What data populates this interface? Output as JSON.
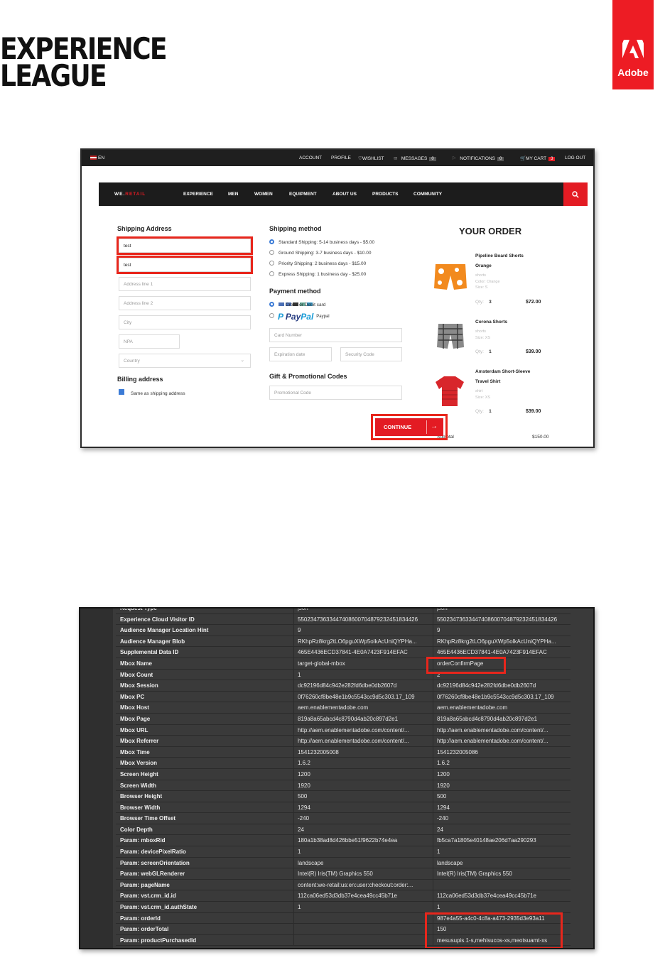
{
  "header": {
    "brand_line1": "EXPERIENCE",
    "brand_line2": "LEAGUE",
    "adobe_label": "Adobe",
    "accent": "#ed1c24"
  },
  "checkout": {
    "topbar": {
      "language": "EN",
      "links": [
        "ACCOUNT",
        "PROFILE",
        "WISHLIST",
        "MESSAGES",
        "NOTIFICATIONS",
        "MY CART",
        "LOG OUT"
      ],
      "messages_count": "0",
      "notifications_count": "0",
      "cart_count": "3"
    },
    "nav": {
      "logo_prefix": "WE.",
      "logo_suffix": "RETAIL",
      "items": [
        "EXPERIENCE",
        "MEN",
        "WOMEN",
        "EQUIPMENT",
        "ABOUT US",
        "PRODUCTS",
        "COMMUNITY"
      ]
    },
    "shipping_address": {
      "title": "Shipping Address",
      "first_name": "test",
      "last_name": "test",
      "address1_placeholder": "Address line 1",
      "address2_placeholder": "Address line 2",
      "city_placeholder": "City",
      "npa_placeholder": "NPA",
      "country_placeholder": "Country"
    },
    "billing": {
      "title": "Billing address",
      "same_as_shipping": "Same as shipping address"
    },
    "shipping_method": {
      "title": "Shipping method",
      "options": [
        "Standard Shipping: 5-14 business days - $5.00",
        "Ground Shipping: 3-7 business days - $10.00",
        "Priority Shipping: 2 business days - $15.00",
        "Express Shipping: 1 business day - $25.00"
      ]
    },
    "payment": {
      "title": "Payment method",
      "card_option": "Credit or Debit card",
      "paypal_word1": "Pay",
      "paypal_word2": "Pal",
      "paypal_option": "Paypal",
      "card_number_placeholder": "Card Number",
      "expiration_placeholder": "Expiration date",
      "security_placeholder": "Security Code"
    },
    "promo": {
      "title": "Gift & Promotional Codes",
      "placeholder": "Promotional Code"
    },
    "continue_label": "CONTINUE",
    "order": {
      "title": "YOUR ORDER",
      "items": [
        {
          "name": "Pipeline Board Shorts Orange",
          "type": "shorts",
          "color": "Color: Orange",
          "size": "Size: S",
          "qty_label": "Qty:",
          "qty": "3",
          "price": "$72.00"
        },
        {
          "name": "Corona Shorts",
          "type": "shorts",
          "color": "",
          "size": "Size: XS",
          "qty_label": "Qty:",
          "qty": "1",
          "price": "$39.00"
        },
        {
          "name": "Amsterdam Short-Sleeve Travel Shirt",
          "type": "shirt",
          "color": "",
          "size": "Size: XS",
          "qty_label": "Qty:",
          "qty": "1",
          "price": "$39.00"
        }
      ],
      "subtotal_label": "Subtotal",
      "subtotal": "$150.00"
    }
  },
  "debugger": {
    "rows": [
      [
        "Request Type",
        "json",
        "json"
      ],
      [
        "Experience Cloud Visitor ID",
        "55023473633447408600704879232451834426",
        "55023473633447408600704879232451834426"
      ],
      [
        "Audience Manager Location Hint",
        "9",
        "9"
      ],
      [
        "Audience Manager Blob",
        "RKhpRz8krg2tLO6pguXWp5olkAcUniQYPHa...",
        "RKhpRz8krg2tLO6pguXWp5olkAcUniQYPHa..."
      ],
      [
        "Supplemental Data ID",
        "465E4436ECD37841-4E0A7423F914EFAC",
        "465E4436ECD37841-4E0A7423F914EFAC"
      ],
      [
        "Mbox Name",
        "target-global-mbox",
        "orderConfirmPage"
      ],
      [
        "Mbox Count",
        "1",
        "2"
      ],
      [
        "Mbox Session",
        "dc92196d84c942e282fd6dbe0db2607d",
        "dc92196d84c942e282fd6dbe0db2607d"
      ],
      [
        "Mbox PC",
        "0f76260cf8be48e1b9c5543cc9d5c303.17_109",
        "0f76260cf8be48e1b9c5543cc9d5c303.17_109"
      ],
      [
        "Mbox Host",
        "aem.enablementadobe.com",
        "aem.enablementadobe.com"
      ],
      [
        "Mbox Page",
        "819a8a65abcd4c8790d4ab20c897d2e1",
        "819a8a65abcd4c8790d4ab20c897d2e1"
      ],
      [
        "Mbox URL",
        "http://aem.enablementadobe.com/content/...",
        "http://aem.enablementadobe.com/content/..."
      ],
      [
        "Mbox Referrer",
        "http://aem.enablementadobe.com/content/...",
        "http://aem.enablementadobe.com/content/..."
      ],
      [
        "Mbox Time",
        "1541232005008",
        "1541232005086"
      ],
      [
        "Mbox Version",
        "1.6.2",
        "1.6.2"
      ],
      [
        "Screen Height",
        "1200",
        "1200"
      ],
      [
        "Screen Width",
        "1920",
        "1920"
      ],
      [
        "Browser Height",
        "500",
        "500"
      ],
      [
        "Browser Width",
        "1294",
        "1294"
      ],
      [
        "Browser Time Offset",
        "-240",
        "-240"
      ],
      [
        "Color Depth",
        "24",
        "24"
      ],
      [
        "Param: mboxRid",
        "180a1b38ad8d426bbe51f9622b74e4ea",
        "fb5ca7a1805e40148ae206d7aa290293"
      ],
      [
        "Param: devicePixelRatio",
        "1",
        "1"
      ],
      [
        "Param: screenOrientation",
        "landscape",
        "landscape"
      ],
      [
        "Param: webGLRenderer",
        "Intel(R) Iris(TM) Graphics 550",
        "Intel(R) Iris(TM) Graphics 550"
      ],
      [
        "Param: pageName",
        "content:we-retail:us:en:user:checkout:order:...",
        ""
      ],
      [
        "Param: vst.crm_id.id",
        "112ca06ed53d3db37e4cea49cc45b71e",
        "112ca06ed53d3db37e4cea49cc45b71e"
      ],
      [
        "Param: vst.crm_id.authState",
        "1",
        "1"
      ],
      [
        "Param: orderId",
        "",
        "987e4a55-a4c0-4c8a-a473-2935d3e93a11"
      ],
      [
        "Param: orderTotal",
        "",
        "150"
      ],
      [
        "Param: productPurchasedId",
        "",
        "mesusupis.1-s,mehisucos-xs,meotsuamt-xs"
      ]
    ]
  }
}
